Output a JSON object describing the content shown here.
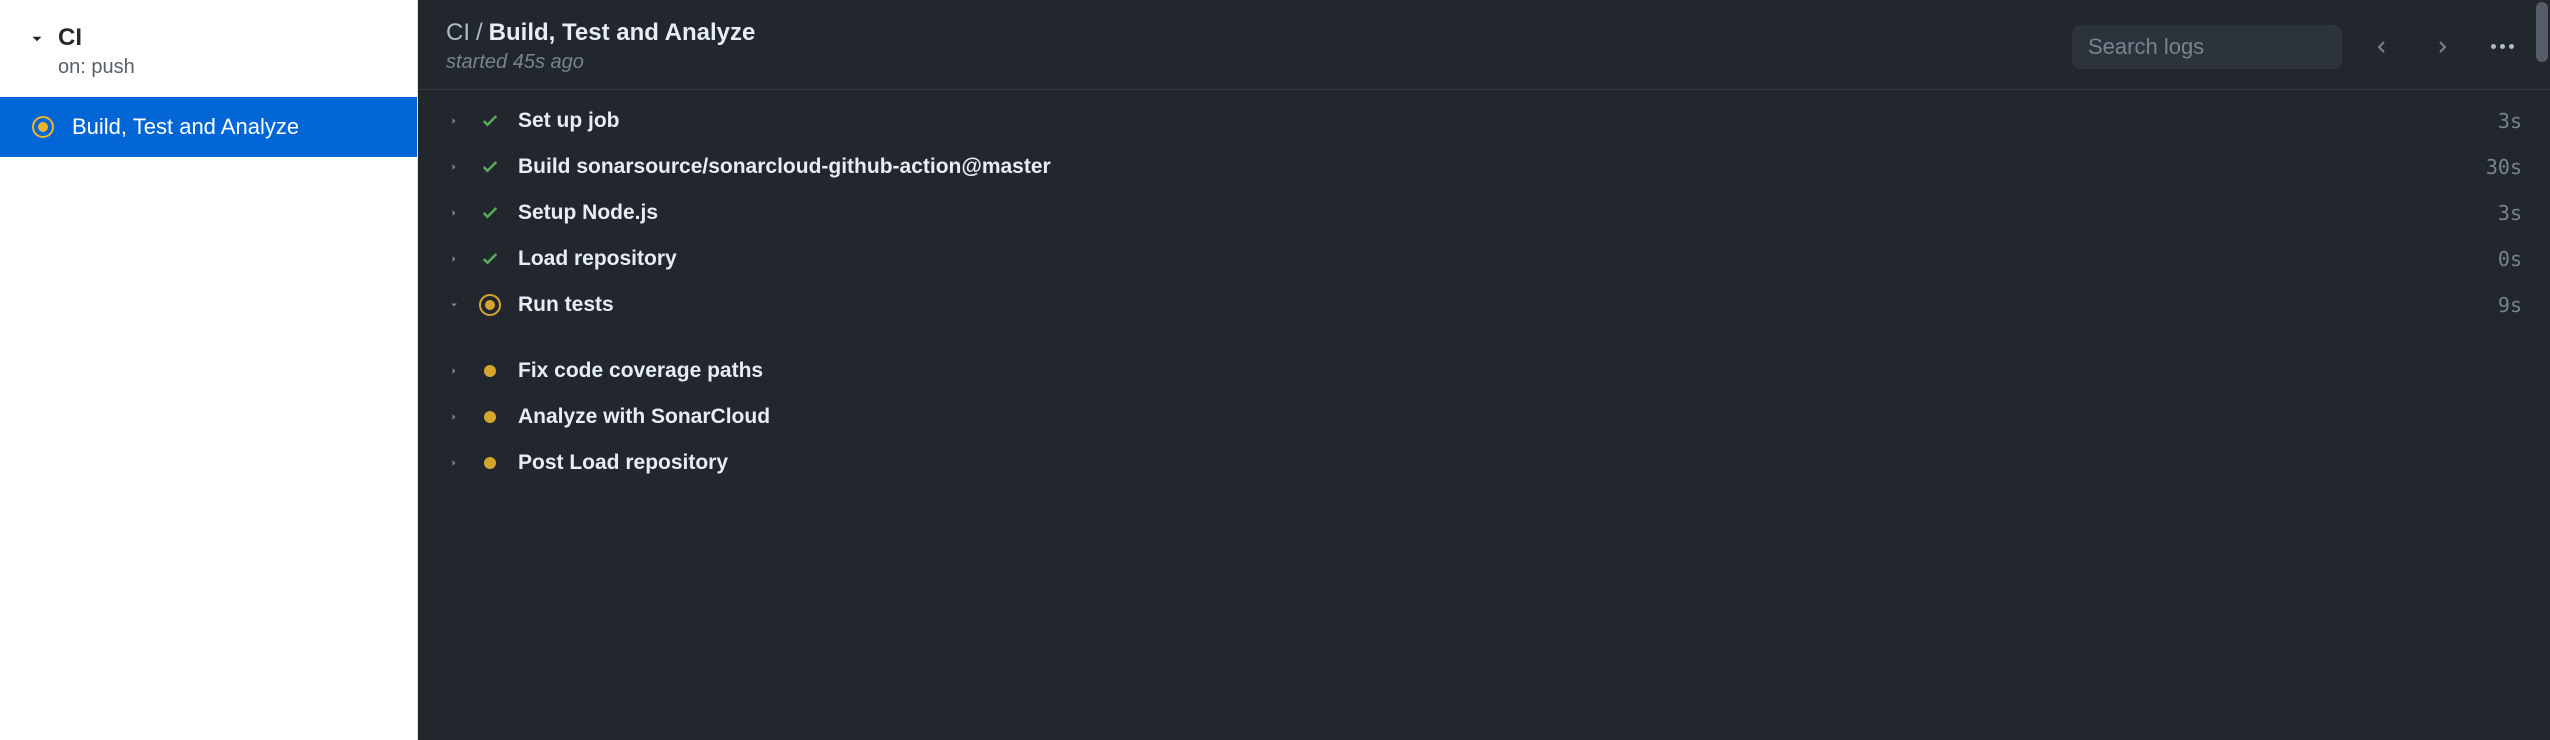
{
  "sidebar": {
    "workflow_name": "CI",
    "trigger_text": "on: push",
    "jobs": [
      {
        "name": "Build, Test and Analyze",
        "status": "in_progress",
        "selected": true
      }
    ]
  },
  "header": {
    "workflow": "CI",
    "separator": "/",
    "job": "Build, Test and Analyze",
    "started_text": "started 45s ago",
    "search_placeholder": "Search logs"
  },
  "steps": [
    {
      "name": "Set up job",
      "status": "success",
      "expanded": false,
      "duration": "3s"
    },
    {
      "name": "Build sonarsource/sonarcloud-github-action@master",
      "status": "success",
      "expanded": false,
      "duration": "30s"
    },
    {
      "name": "Setup Node.js",
      "status": "success",
      "expanded": false,
      "duration": "3s"
    },
    {
      "name": "Load repository",
      "status": "success",
      "expanded": false,
      "duration": "0s"
    },
    {
      "name": "Run tests",
      "status": "in_progress",
      "expanded": true,
      "duration": "9s"
    },
    {
      "name": "Fix code coverage paths",
      "status": "queued",
      "expanded": false,
      "duration": ""
    },
    {
      "name": "Analyze with SonarCloud",
      "status": "queued",
      "expanded": false,
      "duration": ""
    },
    {
      "name": "Post Load repository",
      "status": "queued",
      "expanded": false,
      "duration": ""
    }
  ]
}
